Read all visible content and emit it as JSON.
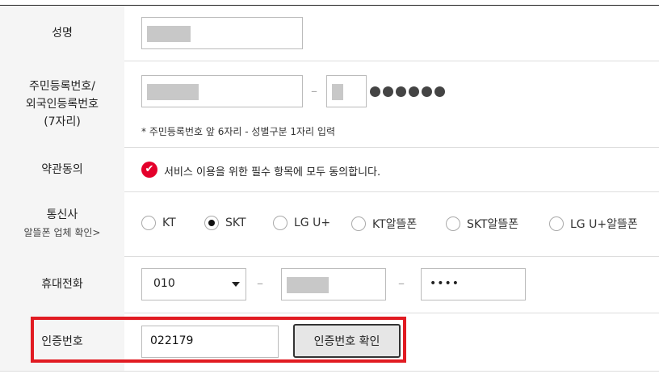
{
  "form": {
    "name": {
      "label": "성명"
    },
    "resident": {
      "label_line1": "주민등록번호/",
      "label_line2": "외국인등록번호",
      "label_line3": "(7자리)",
      "dash": "–",
      "note": "* 주민등록번호 앞 6자리 - 성별구분 1자리 입력"
    },
    "terms": {
      "label": "약관동의",
      "text": "서비스 이용을 위한 필수 항목에 모두 동의합니다.",
      "checked_icon": "✔"
    },
    "carrier": {
      "label": "통신사",
      "sub_label": "알뜰폰 업체 확인>",
      "options": [
        "KT",
        "SKT",
        "LG U+",
        "KT알뜰폰",
        "SKT알뜰폰",
        "LG U+알뜰폰"
      ],
      "selected": "SKT"
    },
    "phone": {
      "label": "휴대전화",
      "prefix": "010",
      "dash": "–",
      "last": "••••"
    },
    "auth": {
      "label": "인증번호",
      "code": "022179",
      "confirm_button": "인증번호 확인"
    }
  },
  "colors": {
    "accent": "#e11b22",
    "label_bg": "#f5f5f5",
    "check": "#e4002b"
  }
}
